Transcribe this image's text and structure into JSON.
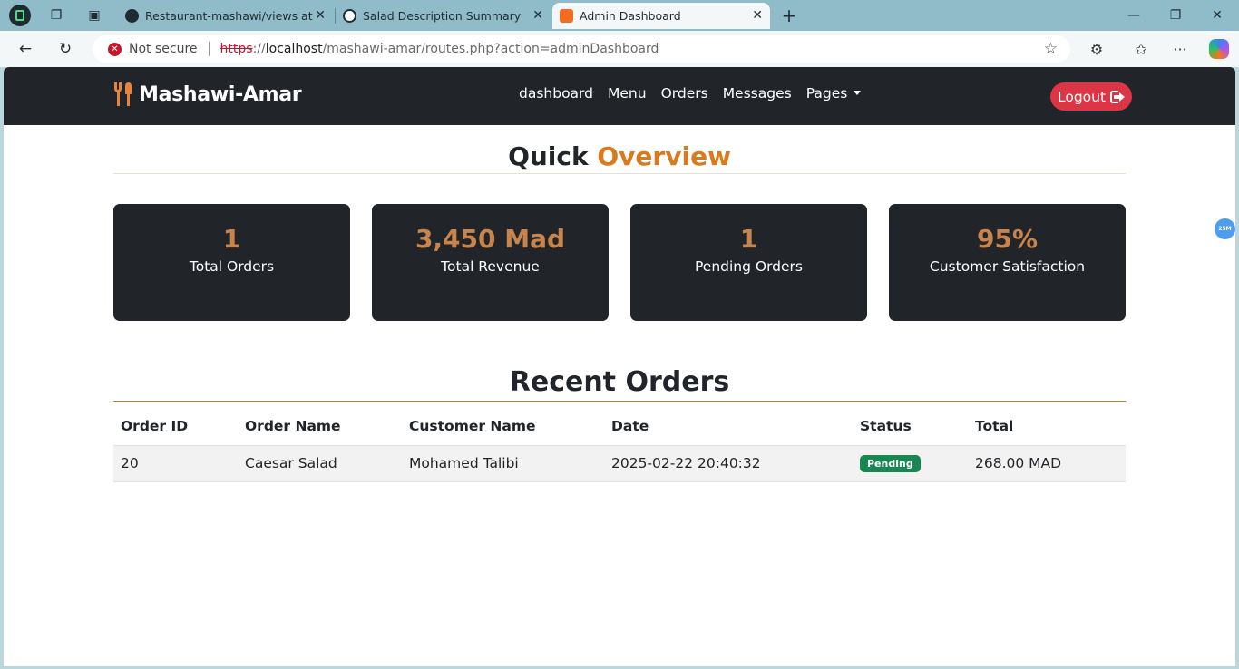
{
  "browser": {
    "tabs": [
      {
        "title": "Restaurant-mashawi/views at main",
        "favicon": "github-icon",
        "active": false
      },
      {
        "title": "Salad Description Summary",
        "favicon": "chatgpt-icon",
        "active": false
      },
      {
        "title": "Admin Dashboard",
        "favicon": "xampp-icon",
        "active": true
      }
    ],
    "address": {
      "security_text": "Not secure",
      "url_scheme": "https",
      "url_sep": "://",
      "url_host": "localhost",
      "url_path": "/mashawi-amar/routes.php?action=adminDashboard"
    },
    "extension_badge": "25M"
  },
  "navbar": {
    "brand": "Mashawi-Amar",
    "links": [
      "dashboard",
      "Menu",
      "Orders",
      "Messages",
      "Pages"
    ],
    "logout_label": "Logout"
  },
  "overview": {
    "title_part1": "Quick",
    "title_part2": "Overview",
    "stats": [
      {
        "value": "1",
        "label": "Total Orders"
      },
      {
        "value": "3,450 Mad",
        "label": "Total Revenue"
      },
      {
        "value": "1",
        "label": "Pending Orders"
      },
      {
        "value": "95%",
        "label": "Customer Satisfaction"
      }
    ]
  },
  "recent_orders": {
    "title": "Recent Orders",
    "columns": [
      "Order ID",
      "Order Name",
      "Customer Name",
      "Date",
      "Status",
      "Total"
    ],
    "rows": [
      {
        "id": "20",
        "name": "Caesar Salad",
        "customer": "Mohamed Talibi",
        "date": "2025-02-22 20:40:32",
        "status": "Pending",
        "total": "268.00 MAD"
      }
    ]
  },
  "colors": {
    "navbar_bg": "#212529",
    "accent": "#d97a1e",
    "stat_value": "#c8844a",
    "logout_bg": "#dc3545",
    "status_pending": "#198754"
  }
}
